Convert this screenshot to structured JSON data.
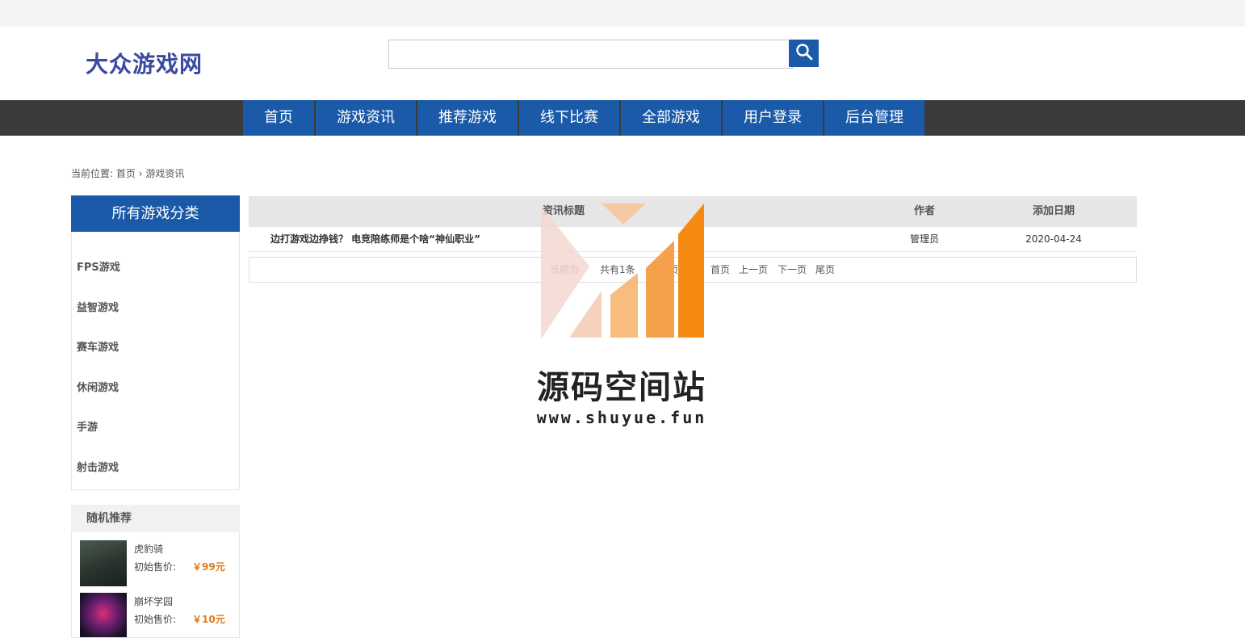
{
  "site": {
    "logo": "大众游戏网"
  },
  "search": {
    "placeholder": "",
    "button_icon": "search-icon"
  },
  "nav": {
    "items": [
      {
        "label": "首页"
      },
      {
        "label": "游戏资讯"
      },
      {
        "label": "推荐游戏"
      },
      {
        "label": "线下比赛"
      },
      {
        "label": "全部游戏"
      },
      {
        "label": "用户登录"
      },
      {
        "label": "后台管理"
      }
    ]
  },
  "breadcrumb": {
    "prefix": "当前位置:",
    "home": "首页",
    "separator": "›",
    "current": "游戏资讯"
  },
  "sidebar": {
    "category_title": "所有游戏分类",
    "categories": [
      "FPS游戏",
      "益智游戏",
      "赛车游戏",
      "休闲游戏",
      "手游",
      "射击游戏"
    ],
    "recommend_title": "随机推荐",
    "recommend": [
      {
        "name": "虎豹骑",
        "price_label": "初始售价:",
        "price": "￥99元"
      },
      {
        "name": "崩坏学园",
        "price_label": "初始售价:",
        "price": "￥10元"
      }
    ]
  },
  "table": {
    "headers": {
      "title": "资讯标题",
      "author": "作者",
      "date": "添加日期"
    },
    "rows": [
      {
        "title": "边打游戏边挣钱？ 电竞陪练师是个啥“神仙职业”",
        "author": "管理员",
        "date": "2020-04-24"
      }
    ]
  },
  "pager": {
    "status_start": "当前为",
    "total": "共有1条",
    "status_end": "1/1页",
    "first": "首页",
    "prev": "上一页",
    "next": "下一页",
    "last": "尾页"
  },
  "watermark": {
    "name": "源码空间站",
    "url": "www.shuyue.fun"
  },
  "colors": {
    "brand": "#1a5aa8",
    "nav_bg": "#3b3b3b",
    "price": "#e07a1b",
    "logo": "#3a4aa0"
  }
}
